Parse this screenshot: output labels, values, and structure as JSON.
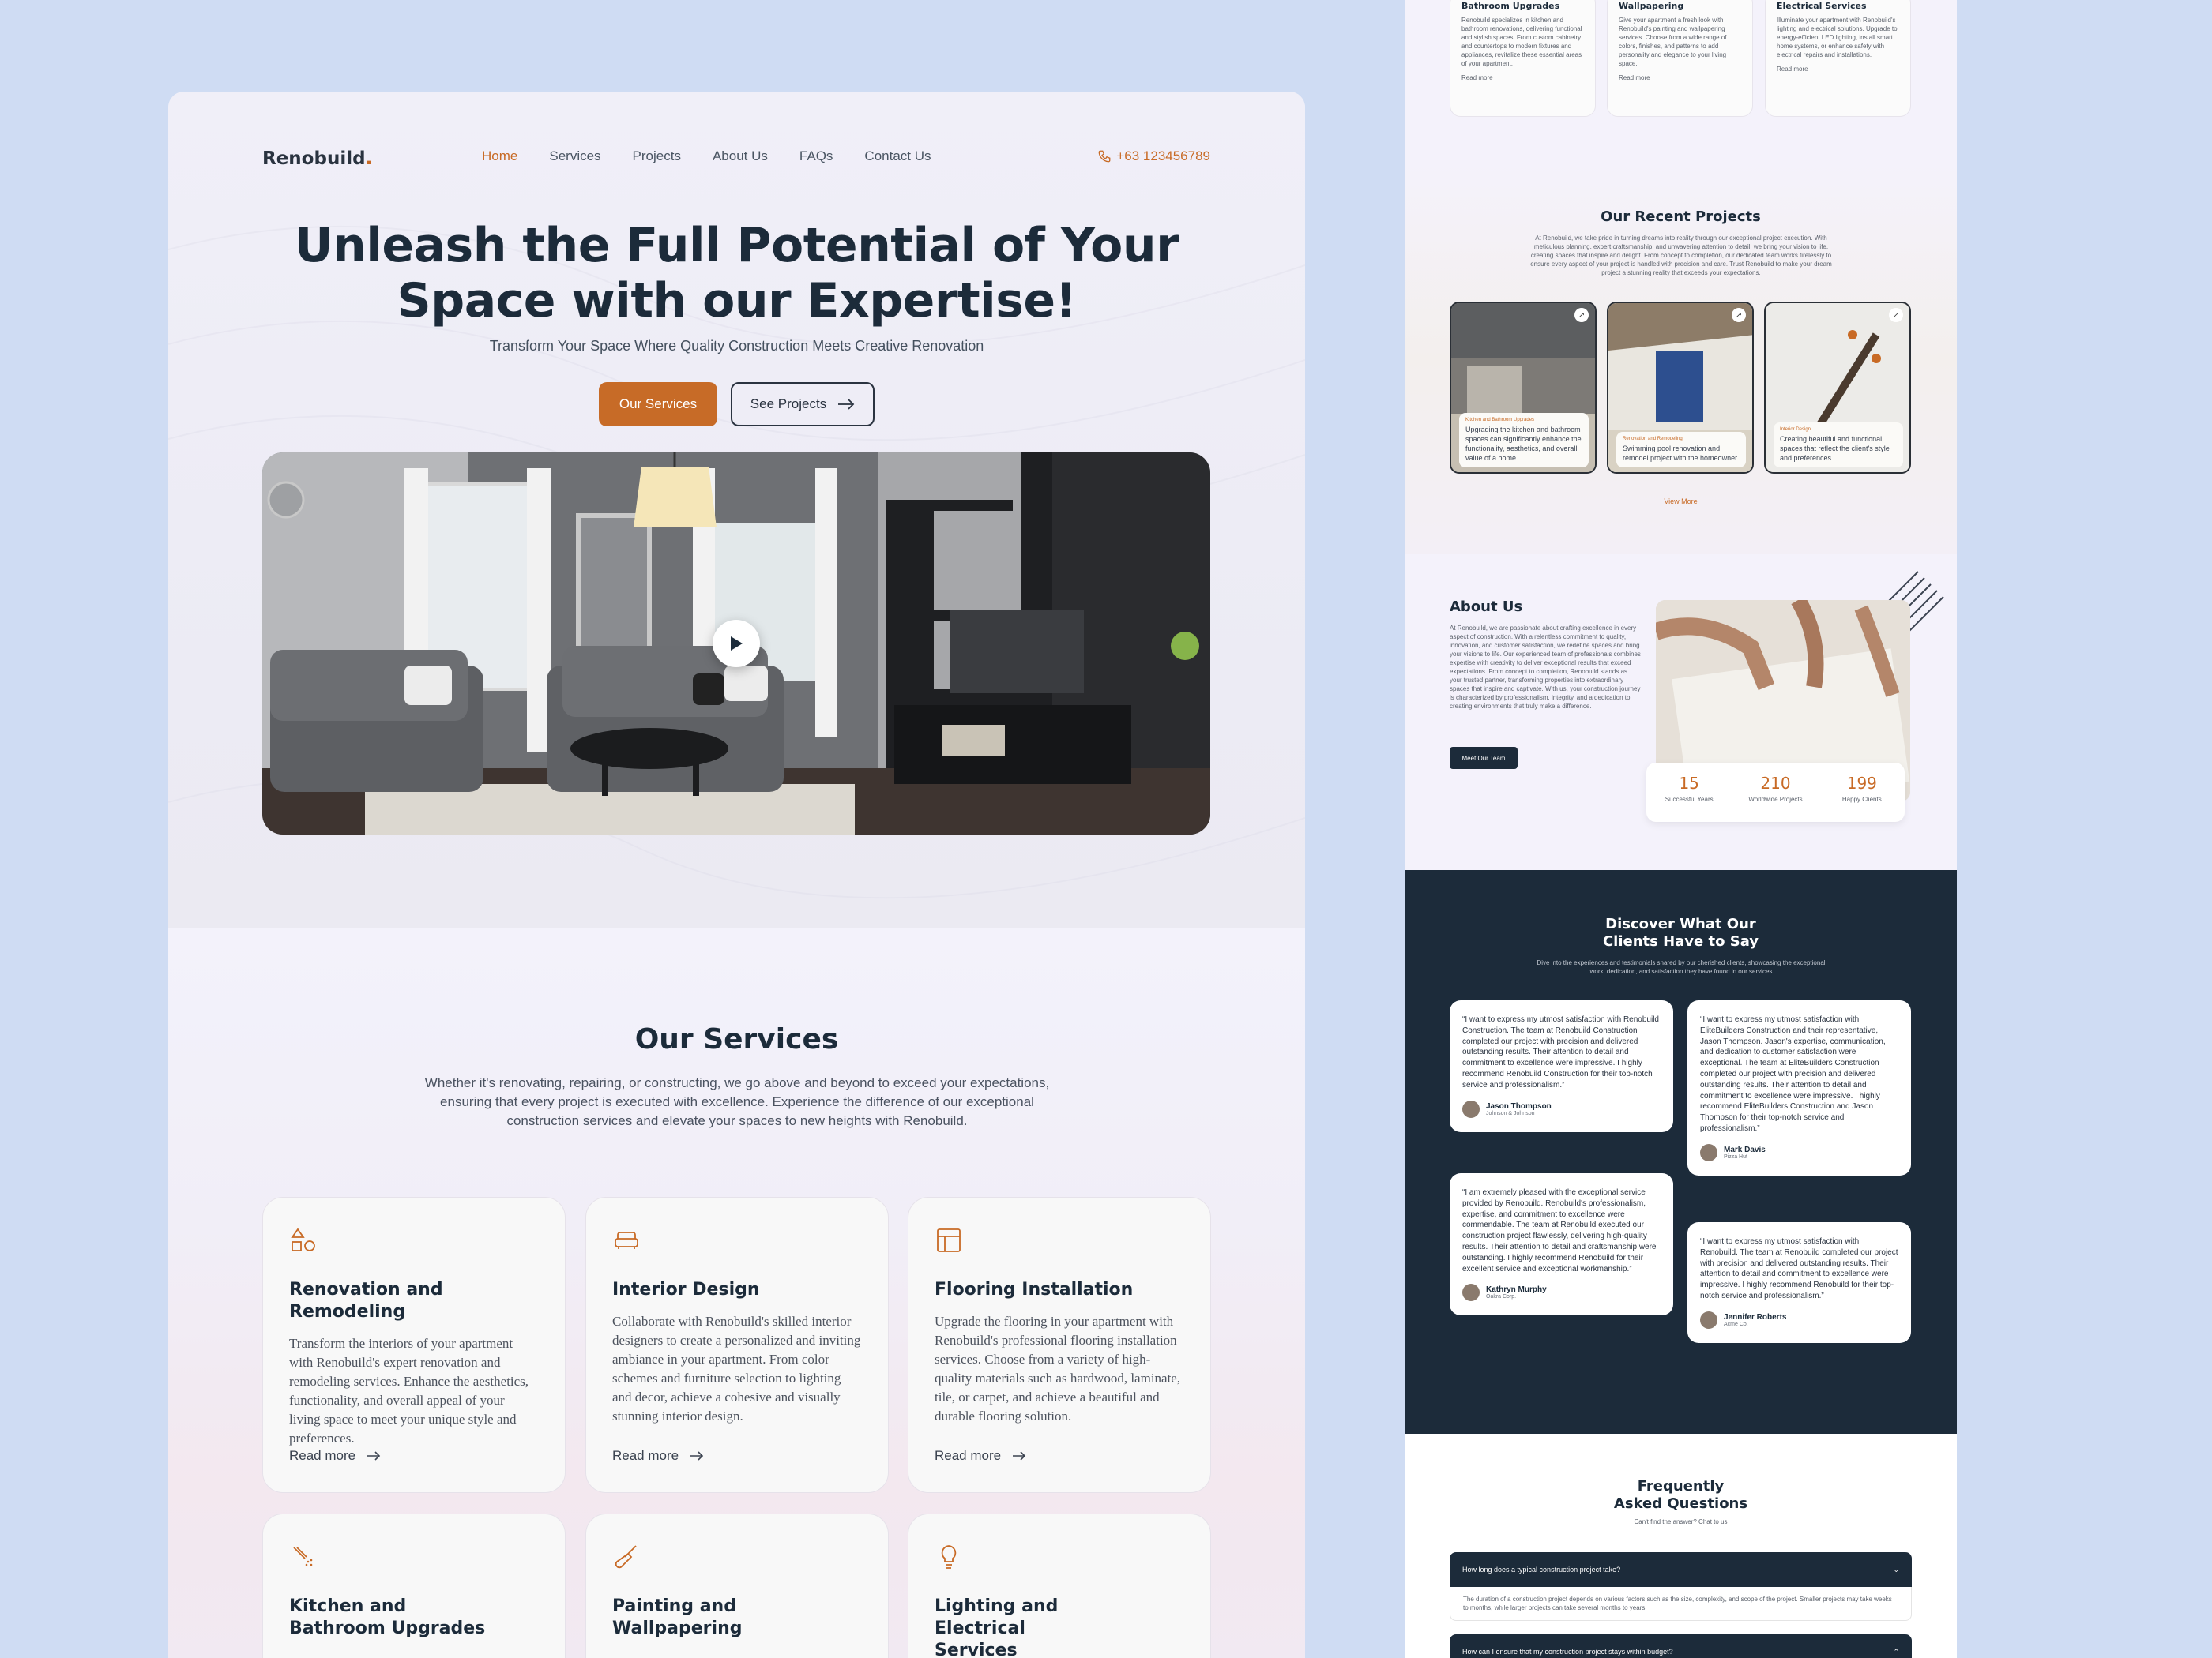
{
  "colors": {
    "accent": "#c76b27",
    "navy": "#1c2b3a",
    "bg": "#cfdcf3"
  },
  "nav": {
    "logo": "Renobuild",
    "logo_dot": ".",
    "links": [
      "Home",
      "Services",
      "Projects",
      "About Us",
      "FAQs",
      "Contact Us"
    ],
    "phone": "+63 123456789"
  },
  "hero": {
    "title_line1": "Unleash the Full Potential of Your",
    "title_line2": "Space with our Expertise!",
    "subtitle": "Transform Your Space Where Quality Construction Meets Creative Renovation",
    "btn_services": "Our Services",
    "btn_projects": "See Projects"
  },
  "services": {
    "title": "Our Services",
    "desc": "Whether it's renovating, repairing, or constructing, we go above and beyond to exceed your expectations, ensuring that every project is executed with excellence. Experience the difference of our exceptional construction services and elevate your spaces to new heights with Renobuild.",
    "read_more": "Read more",
    "cards": [
      {
        "icon": "shapes-icon",
        "title": "Renovation and Remodeling",
        "text": "Transform the interiors of your apartment with Renobuild's expert renovation and remodeling services. Enhance the aesthetics, functionality, and overall appeal of your living space to meet your unique style and preferences."
      },
      {
        "icon": "sofa-icon",
        "title": "Interior Design",
        "text": "Collaborate with Renobuild's skilled interior designers to create a personalized and inviting ambiance in your apartment. From color schemes and furniture selection to lighting and decor, achieve a cohesive and visually stunning interior design."
      },
      {
        "icon": "layout-icon",
        "title": "Flooring Installation",
        "text": "Upgrade the flooring in your apartment with Renobuild's professional flooring installation services. Choose from a variety of high-quality materials such as hardwood, laminate, tile, or carpet, and achieve a beautiful and durable flooring solution."
      },
      {
        "icon": "shower-icon",
        "title": "Kitchen and Bathroom Upgrades",
        "text": ""
      },
      {
        "icon": "brush-icon",
        "title": "Painting and Wallpapering",
        "text": ""
      },
      {
        "icon": "bulb-icon",
        "title": "Lighting and Electrical Services",
        "text": ""
      }
    ]
  },
  "right": {
    "top_cards": [
      {
        "title": "Bathroom Upgrades",
        "text": "Renobuild specializes in kitchen and bathroom renovations, delivering functional and stylish spaces. From custom cabinetry and countertops to modern fixtures and appliances, revitalize these essential areas of your apartment.",
        "more": "Read more"
      },
      {
        "title": "Wallpapering",
        "text": "Give your apartment a fresh look with Renobuild's painting and wallpapering services. Choose from a wide range of colors, finishes, and patterns to add personality and elegance to your living space.",
        "more": "Read more"
      },
      {
        "title": "Electrical Services",
        "text": "Illuminate your apartment with Renobuild's lighting and electrical solutions. Upgrade to energy-efficient LED lighting, install smart home systems, or enhance safety with electrical repairs and installations.",
        "more": "Read more"
      }
    ],
    "projects": {
      "title": "Our Recent Projects",
      "desc": "At Renobuild, we take pride in turning dreams into reality through our exceptional project execution. With meticulous planning, expert craftsmanship, and unwavering attention to detail, we bring your vision to life, creating spaces that inspire and delight. From concept to completion, our dedicated team works tirelessly to ensure every aspect of your project is handled with precision and care. Trust Renobuild to make your dream project a stunning reality that exceeds your expectations.",
      "items": [
        {
          "tag": "Kitchen and Bathroom Upgrades",
          "text": "Upgrading the kitchen and bathroom spaces can significantly enhance the functionality, aesthetics, and overall value of a home."
        },
        {
          "tag": "Renovation and Remodeling",
          "text": "Swimming pool renovation and remodel project with the homeowner."
        },
        {
          "tag": "Interior Design",
          "text": "Creating beautiful and functional spaces that reflect the client's style and preferences."
        }
      ],
      "view_more": "View More"
    },
    "about": {
      "title": "About Us",
      "text": "At Renobuild, we are passionate about crafting excellence in every aspect of construction. With a relentless commitment to quality, innovation, and customer satisfaction, we redefine spaces and bring your visions to life. Our experienced team of professionals combines expertise with creativity to deliver exceptional results that exceed expectations. From concept to completion, Renobuild stands as your trusted partner, transforming properties into extraordinary spaces that inspire and captivate. With us, your construction journey is characterized by professionalism, integrity, and a dedication to creating environments that truly make a difference.",
      "button": "Meet Our Team",
      "stats": [
        {
          "n": "15",
          "l": "Successful Years"
        },
        {
          "n": "210",
          "l": "Worldwide Projects"
        },
        {
          "n": "199",
          "l": "Happy Clients"
        }
      ]
    },
    "testimonials": {
      "title_line1": "Discover What Our",
      "title_line2": "Clients Have to Say",
      "desc": "Dive into the experiences and testimonials shared by our cherished clients, showcasing the exceptional work, dedication, and satisfaction they have found in our services",
      "items": [
        {
          "quote": "“I want to express my utmost satisfaction with Renobuild Construction. The team at Renobuild Construction completed our project with precision and delivered outstanding results. Their attention to detail and commitment to excellence were impressive. I highly recommend Renobuild Construction for their top-notch service and professionalism.”",
          "name": "Jason Thompson",
          "company": "Johnson & Johnson"
        },
        {
          "quote": "“I want to express my utmost satisfaction with EliteBuilders Construction and their representative, Jason Thompson. Jason's expertise, communication, and dedication to customer satisfaction were exceptional. The team at EliteBuilders Construction completed our project with precision and delivered outstanding results. Their attention to detail and commitment to excellence were impressive. I highly recommend EliteBuilders Construction and Jason Thompson for their top-notch service and professionalism.”",
          "name": "Mark Davis",
          "company": "Pizza Hut"
        },
        {
          "quote": "“I am extremely pleased with the exceptional service provided by Renobuild. Renobuild's professionalism, expertise, and commitment to excellence were commendable. The team at Renobuild executed our construction project flawlessly, delivering high-quality results. Their attention to detail and craftsmanship were outstanding. I highly recommend Renobuild for their excellent service and exceptional workmanship.”",
          "name": "Kathryn Murphy",
          "company": "Oakra Corp."
        },
        {
          "quote": "“I want to express my utmost satisfaction with Renobuild. The team at Renobuild completed our project with precision and delivered outstanding results. Their attention to detail and commitment to excellence were impressive. I highly recommend Renobuild for their top-notch service and professionalism.”",
          "name": "Jennifer Roberts",
          "company": "Acme Co."
        }
      ]
    },
    "faq": {
      "title_line1": "Frequently",
      "title_line2": "Asked Questions",
      "sub": "Can't find the answer? Chat to us",
      "items": [
        {
          "q": "How long does a typical construction project take?",
          "a": "The duration of a construction project depends on various factors such as the size, complexity, and scope of the project. Smaller projects may take weeks to months, while larger projects can take several months to years."
        },
        {
          "q": "How can I ensure that my construction project stays within budget?",
          "a": ""
        }
      ]
    }
  }
}
